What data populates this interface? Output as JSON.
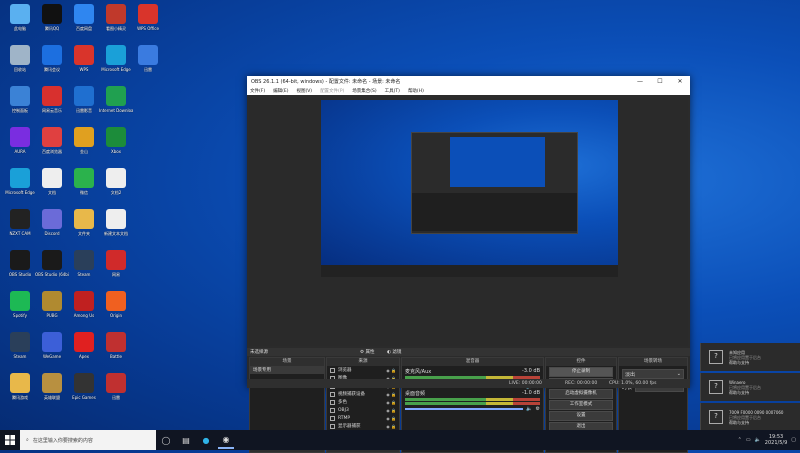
{
  "desktop_icons": [
    {
      "label": "此电脑",
      "color": "#5ab0f0"
    },
    {
      "label": "腾讯QQ",
      "color": "#111"
    },
    {
      "label": "百度网盘",
      "color": "#2f86f0"
    },
    {
      "label": "看图小精灵",
      "color": "#c0392b"
    },
    {
      "label": "WPS Office",
      "color": "#d9342b"
    },
    {
      "label": "回收站",
      "color": "#9fb4c8"
    },
    {
      "label": "腾讯会议",
      "color": "#1c6fe0"
    },
    {
      "label": "WPS",
      "color": "#d9342b"
    },
    {
      "label": "Microsoft Edge",
      "color": "#1aa0d8"
    },
    {
      "label": "迅雷",
      "color": "#3a7be0"
    },
    {
      "label": "控制面板",
      "color": "#3b82d6"
    },
    {
      "label": "网易云音乐",
      "color": "#d8302e"
    },
    {
      "label": "迅雷影音",
      "color": "#1f6fd0"
    },
    {
      "label": "Internet Download",
      "color": "#20a050"
    },
    {
      "label": "AURA",
      "color": "#7a2de0"
    },
    {
      "label": "百度浏览器",
      "color": "#e04040"
    },
    {
      "label": "金山",
      "color": "#e0a020"
    },
    {
      "label": "Xbox",
      "color": "#1c8c3a"
    },
    {
      "label": "Microsoft Edge",
      "color": "#1aa0d8"
    },
    {
      "label": "文档",
      "color": "#eeeeee"
    },
    {
      "label": "微信",
      "color": "#2bb24c"
    },
    {
      "label": "文档2",
      "color": "#eeeeee"
    },
    {
      "label": "NZXT CAM",
      "color": "#222"
    },
    {
      "label": "Discord",
      "color": "#6b6bd8"
    },
    {
      "label": "文件夹",
      "color": "#e8b84a"
    },
    {
      "label": "新建文本文档",
      "color": "#eeeeee"
    },
    {
      "label": "OBS Studio",
      "color": "#1a1a1a"
    },
    {
      "label": "OBS Studio (64bit)",
      "color": "#1a1a1a"
    },
    {
      "label": "Steam",
      "color": "#2a3f5a"
    },
    {
      "label": "网易",
      "color": "#d02a2a"
    },
    {
      "label": "Spotify",
      "color": "#1db954"
    },
    {
      "label": "PUBG",
      "color": "#b08a30"
    },
    {
      "label": "Among Us",
      "color": "#c02020"
    },
    {
      "label": "Origin",
      "color": "#f06020"
    },
    {
      "label": "Steam",
      "color": "#2a3f5a"
    },
    {
      "label": "WeGame",
      "color": "#3c5fd8"
    },
    {
      "label": "Apex",
      "color": "#e02020"
    },
    {
      "label": "Battle",
      "color": "#c03030"
    },
    {
      "label": "腾讯游戏",
      "color": "#e8b84a"
    },
    {
      "label": "英雄联盟",
      "color": "#b89040"
    },
    {
      "label": "Epic Games",
      "color": "#333"
    },
    {
      "label": "迅雷",
      "color": "#c03030"
    }
  ],
  "obs": {
    "title": "OBS 26.1.1 (64-bit, windows) - 配置文件: 未命名 - 场景: 未命名",
    "menu": [
      "文件(F)",
      "编辑(E)",
      "视图(V)",
      "配置文件(P)",
      "场景集合(S)",
      "工具(T)",
      "帮助(H)"
    ],
    "no_source": "未选择源",
    "props_btn": "属性",
    "filters_btn": "滤镜",
    "scenes": {
      "header": "场景",
      "items": [
        "场景专用"
      ]
    },
    "sources": {
      "header": "来源",
      "items": [
        "浏览器",
        "图像",
        "文本 (GDI+)",
        "视频捕获设备",
        "多色",
        "OBJ3",
        "RTMP",
        "显示器捕获"
      ]
    },
    "mixer": {
      "header": "混音器",
      "tracks": [
        {
          "name": "桌面音频",
          "db": "-1.0 dB"
        },
        {
          "name": "麦克风/Aux",
          "db": "-3.0 dB"
        }
      ]
    },
    "transitions": {
      "header": "场景转场",
      "type": "淡出",
      "duration_label": "时长",
      "duration": "300 ms"
    },
    "controls": {
      "header": "控件",
      "buttons": [
        "停止录制",
        "开始录制",
        "启动虚拟摄像机",
        "工作室模式",
        "设置",
        "退出"
      ]
    },
    "status": {
      "live": "LIVE: 00:00:00",
      "rec": "REC: 00:00:00",
      "cpu": "CPU: 1.0%, 60.00 fps"
    }
  },
  "taskbar": {
    "search_placeholder": "在这里输入你要搜索的内容",
    "time": "19:53",
    "date": "2021/5/9"
  },
  "notifications": [
    {
      "title": "未知应用",
      "line1": "已将应用置于后台",
      "line2": "帮助与支持"
    },
    {
      "title": "Winaero",
      "line1": "已将应用置于后台",
      "line2": "帮助与支持"
    },
    {
      "title": "7009 F0000 0090 0007060",
      "line1": "已将应用置于后台",
      "line2": "帮助与支持"
    }
  ]
}
